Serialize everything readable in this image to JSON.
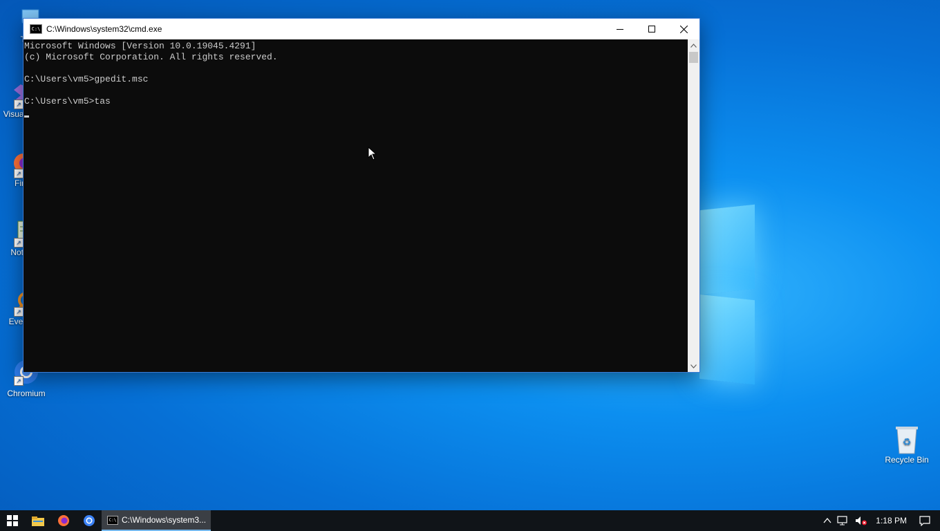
{
  "desktop": {
    "icons": [
      {
        "label": "Thi"
      },
      {
        "label": "Visua 20"
      },
      {
        "label": "Fir"
      },
      {
        "label": "Note"
      },
      {
        "label": "Every"
      },
      {
        "label": "Chromium"
      }
    ],
    "recycle_bin": {
      "label": "Recycle Bin"
    }
  },
  "cmd_window": {
    "title": "C:\\Windows\\system32\\cmd.exe",
    "icon_text": "C:\\",
    "lines": [
      "Microsoft Windows [Version 10.0.19045.4291]",
      "(c) Microsoft Corporation. All rights reserved.",
      "",
      "C:\\Users\\vm5>gpedit.msc",
      "",
      "C:\\Users\\vm5>tas"
    ],
    "minimize_icon": "minimize-icon",
    "maximize_icon": "maximize-icon",
    "close_icon": "close-icon"
  },
  "taskbar": {
    "cmd_label": "C:\\Windows\\system3...",
    "cmd_icon_text": "C:\\",
    "clock": "1:18 PM"
  },
  "colors": {
    "console_bg": "#0c0c0c",
    "console_text": "#cccccc",
    "taskbar_bg": "#101418",
    "active_task_underline": "#76b9ed"
  }
}
